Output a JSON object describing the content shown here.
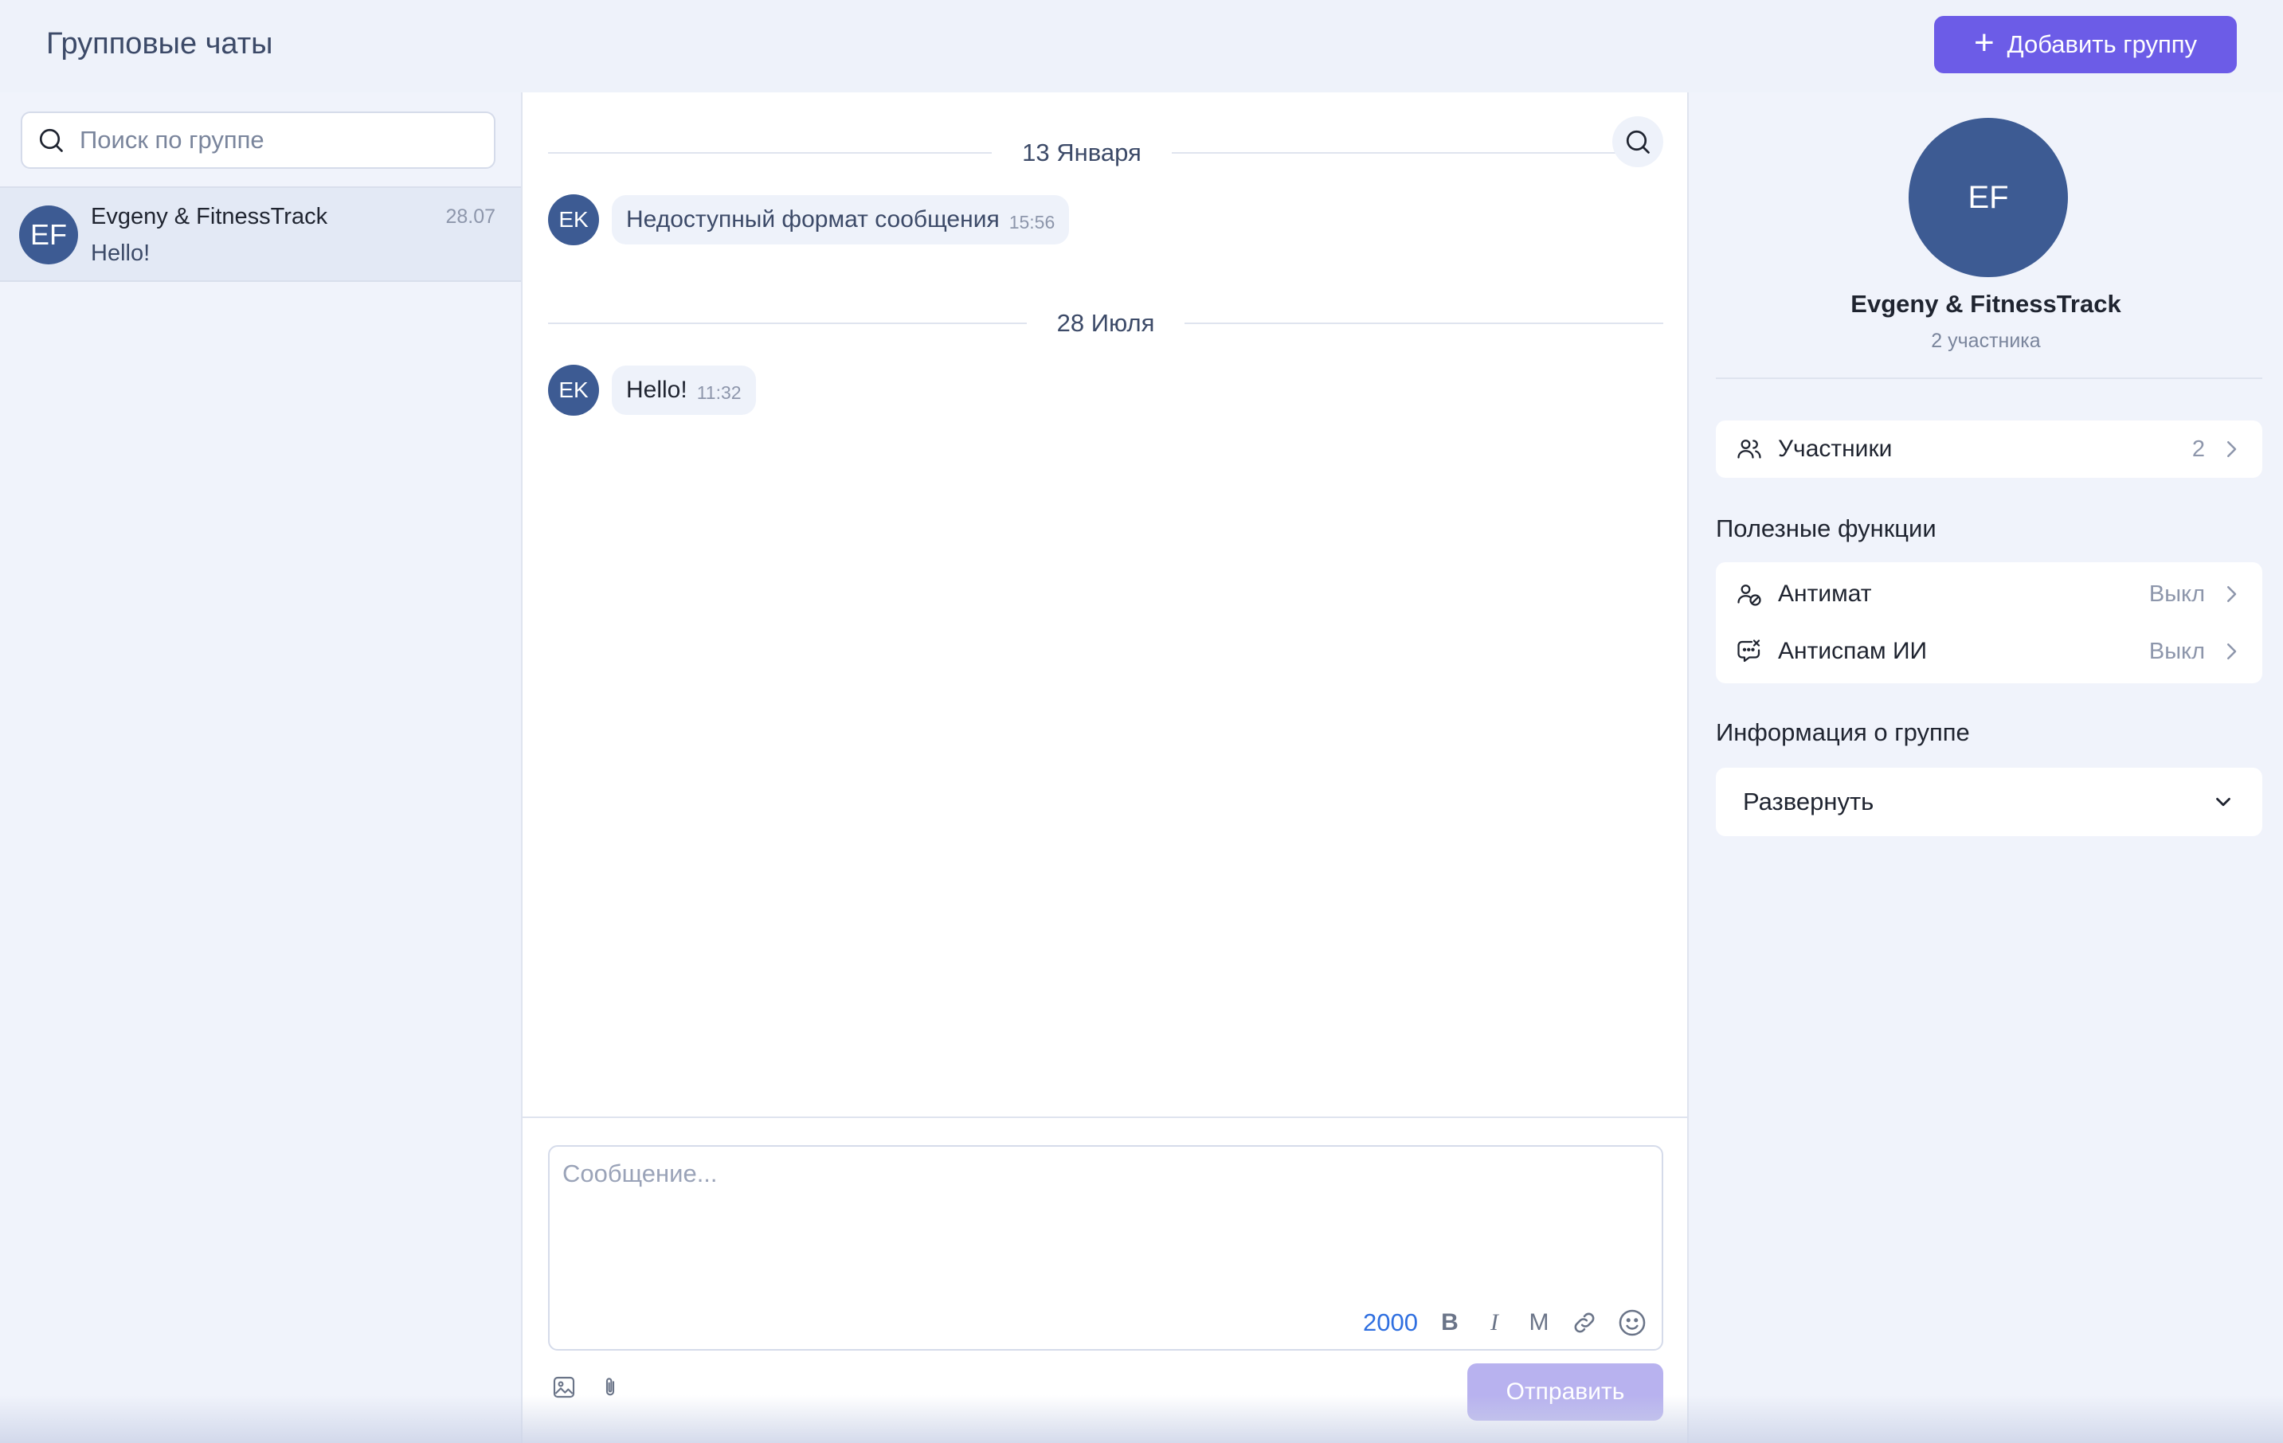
{
  "header": {
    "title": "Групповые чаты",
    "add_group_label": "Добавить группу"
  },
  "sidebar": {
    "search_placeholder": "Поиск по группе",
    "chats": [
      {
        "avatar_initials": "EF",
        "name": "Evgeny & FitnessTrack",
        "date": "28.07",
        "preview": "Hello!",
        "selected": true
      }
    ]
  },
  "conversation": {
    "groups": [
      {
        "date_label": "13 Января",
        "messages": [
          {
            "avatar_initials": "EK",
            "text": "Недоступный формат сообщения",
            "time": "15:56"
          }
        ]
      },
      {
        "date_label": "28 Июля",
        "messages": [
          {
            "avatar_initials": "EK",
            "text": "Hello!",
            "time": "11:32"
          }
        ]
      }
    ],
    "composer": {
      "placeholder": "Сообщение...",
      "char_limit": "2000",
      "tools": {
        "bold": "B",
        "italic": "I",
        "mono": "M"
      },
      "send_label": "Отправить"
    }
  },
  "group_info": {
    "avatar_initials": "EF",
    "name": "Evgeny & FitnessTrack",
    "members_count_label": "2 участника",
    "members_row": {
      "label": "Участники",
      "value": "2"
    },
    "useful_title": "Полезные функции",
    "features": [
      {
        "label": "Антимат",
        "value": "Выкл",
        "icon": "antimat-icon"
      },
      {
        "label": "Антиспам ИИ",
        "value": "Выкл",
        "icon": "antispam-icon"
      }
    ],
    "info_title": "Информация о группе",
    "expand_label": "Развернуть"
  },
  "colors": {
    "accent": "#6c5ce7",
    "avatar": "#3d5b93",
    "send_disabled": "#b8b2ef",
    "char_count": "#2f6fe0"
  }
}
